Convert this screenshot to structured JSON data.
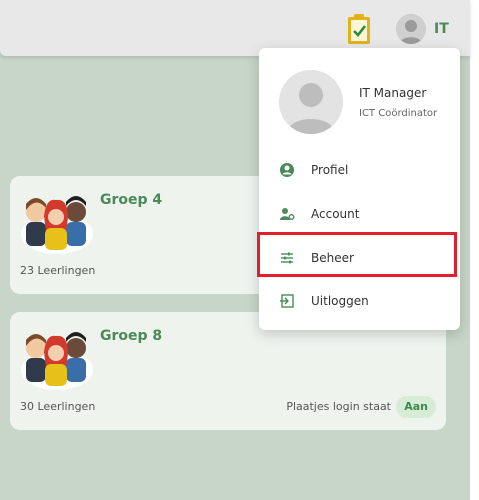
{
  "header": {
    "user_initials": "IT"
  },
  "groups": [
    {
      "name": "Groep 4",
      "students": "23 Leerlingen"
    },
    {
      "name": "Groep 8",
      "students": "30 Leerlingen",
      "login_label": "Plaatjes login staat",
      "login_status": "Aan"
    }
  ],
  "user_menu": {
    "name": "IT Manager",
    "role": "ICT Coördinator",
    "items": [
      {
        "label": "Profiel",
        "icon": "person-circle-icon"
      },
      {
        "label": "Account",
        "icon": "account-settings-icon"
      },
      {
        "label": "Beheer",
        "icon": "sliders-icon"
      },
      {
        "label": "Uitloggen",
        "icon": "logout-icon"
      }
    ]
  },
  "colors": {
    "accent": "#4a8a58",
    "highlight": "#e0202a",
    "clipboard": "#e3b21b"
  }
}
